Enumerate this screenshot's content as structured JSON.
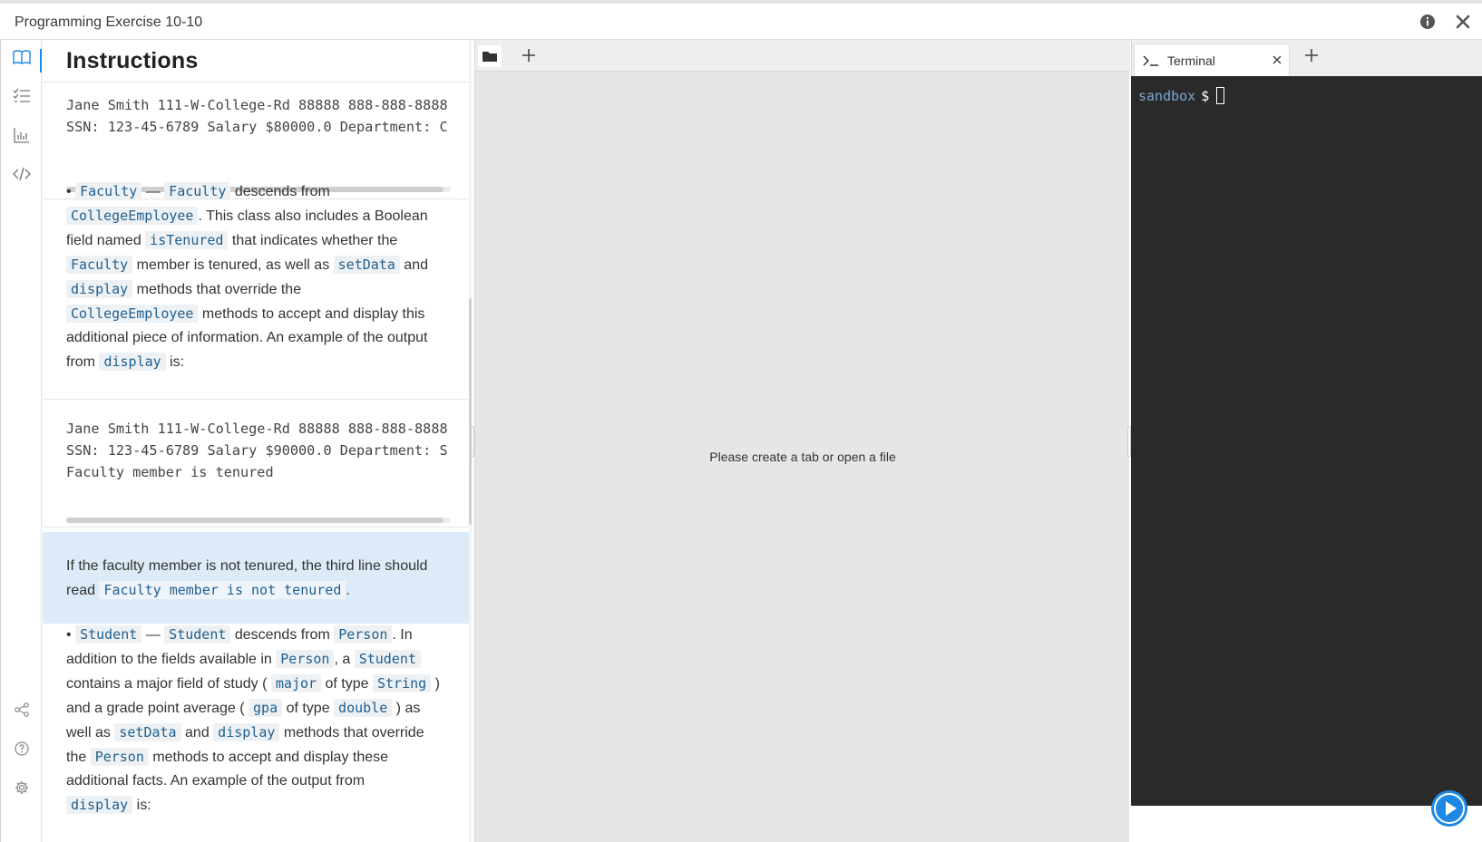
{
  "window": {
    "title": "Programming Exercise 10-10"
  },
  "rail": {
    "icons": [
      "book-icon",
      "checklist-icon",
      "bar-chart-icon",
      "code-icon",
      "share-icon",
      "help-icon",
      "settings-icon"
    ]
  },
  "instructions": {
    "heading": "Instructions",
    "code1": {
      "line1": "Jane Smith 111-W-College-Rd 88888 888-888-8888",
      "line2": "SSN: 123-45-6789 Salary $80000.0 Department: C"
    },
    "faculty": {
      "p1": "Faculty",
      "dash": " — ",
      "p2": "Faculty",
      "t1": " descends from",
      "p3": "CollegeEmployee",
      "t2": ". This class also includes a Boolean",
      "t3": "field named ",
      "p4": "isTenured",
      "t4": " that indicates whether the",
      "p5": "Faculty",
      "t5": " member is tenured, as well as ",
      "p6": "setData",
      "t6": " and",
      "p7": "display",
      "t7": " methods that override the",
      "p8": "CollegeEmployee",
      "t8": " methods to accept and display this",
      "t9": "additional piece of information. An example of the output",
      "t10": "from ",
      "p9": "display",
      "t11": " is:"
    },
    "code2": {
      "line1": "Jane Smith 111-W-College-Rd 88888 888-888-8888",
      "line2": "SSN: 123-45-6789 Salary $90000.0 Department: S",
      "line3": "Faculty member is tenured"
    },
    "callout": {
      "t1": "If the faculty member is not tenured, the third line should",
      "t2": "read ",
      "code": "Faculty member is not tenured",
      "t3": "."
    },
    "student": {
      "p1": "Student",
      "dash": " — ",
      "p2": "Student",
      "t1": " descends from ",
      "p3": "Person",
      "t2": ". In",
      "t3": "addition to the fields available in ",
      "p4": "Person",
      "t4": ", a ",
      "p5": "Student",
      "t5": "contains a major field of study ( ",
      "p6": "major",
      "t6": " of type ",
      "p7": "String",
      "t7": " )",
      "t8": "and a grade point average ( ",
      "p8": "gpa",
      "t9": " of type ",
      "p9": "double",
      "t10": " ) as",
      "t11": "well as ",
      "p10": "setData",
      "t12": " and ",
      "p11": "display",
      "t13": " methods that override",
      "t14": "the ",
      "p12": "Person",
      "t15": " methods to accept and display these",
      "t16": "additional facts. An example of the output from",
      "p13": "display",
      "t17": " is:"
    }
  },
  "editor": {
    "placeholder": "Please create a tab or open a file"
  },
  "terminal": {
    "tab_label": "Terminal",
    "host": "sandbox",
    "prompt": "$"
  }
}
